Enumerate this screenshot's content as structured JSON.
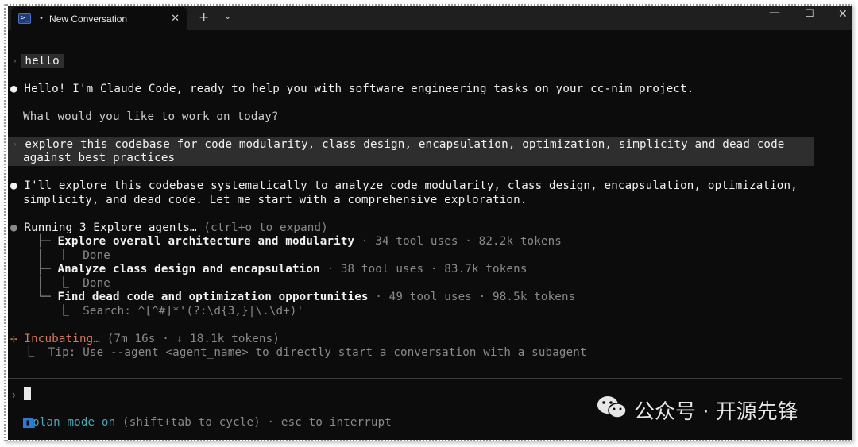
{
  "window": {
    "tab_icon": "powershell-icon",
    "tab_indicator": "•",
    "tab_title": "New Conversation",
    "tab_close": "✕",
    "new_tab": "+",
    "tab_dropdown": "⌄",
    "minimize": "—",
    "maximize": "☐",
    "close": "✕"
  },
  "conversation": {
    "user_prompt_1": "hello",
    "assistant_greeting": "Hello! I'm Claude Code, ready to help you with software engineering tasks on your cc-nim project.",
    "assistant_question": "What would you like to work on today?",
    "user_prompt_2_line1": "explore this codebase for code modularity, class design, encapsulation, optimization, simplicity and dead code",
    "user_prompt_2_line2": "against best practices",
    "assistant_plan_line1": "I'll explore this codebase systematically to analyze code modularity, class design, encapsulation, optimization,",
    "assistant_plan_line2": "simplicity, and dead code. Let me start with a comprehensive exploration.",
    "agents_header": "Running 3 Explore agents…",
    "agents_header_hint": "(ctrl+o to expand)",
    "agents": [
      {
        "task": "Explore overall architecture and modularity",
        "stats": "· 34 tool uses · 82.2k tokens",
        "status": "Done"
      },
      {
        "task": "Analyze class design and encapsulation",
        "stats": "· 38 tool uses · 83.7k tokens",
        "status": "Done"
      },
      {
        "task": "Find dead code and optimization opportunities",
        "stats": "· 49 tool uses · 98.5k tokens",
        "status": "Search: ^[^#]*'(?:\\d{3,}|\\.\\d+)'"
      }
    ],
    "incubating_label": "Incubating…",
    "incubating_stats": "(7m 16s · ↓ 18.1k tokens)",
    "tip": "Tip: Use --agent <agent_name> to directly start a conversation with a subagent"
  },
  "input": {
    "prompt_symbol": "›"
  },
  "status_bar": {
    "mode": "plan mode on",
    "hint": "(shift+tab to cycle) · esc to interrupt"
  },
  "watermark": {
    "text": "公众号 · 开源先锋"
  },
  "colors": {
    "background": "#0c0c0c",
    "accent_orange": "#d97757",
    "plan_mode": "#48a8b8"
  }
}
